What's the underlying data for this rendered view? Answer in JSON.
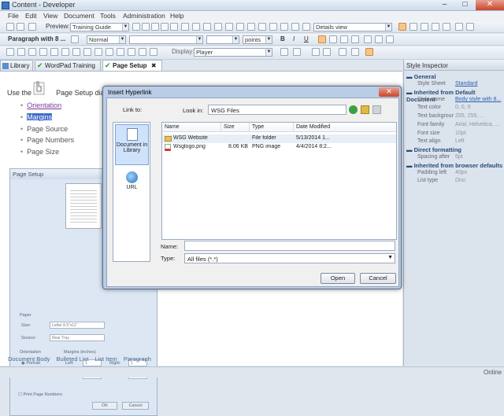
{
  "window": {
    "title": "Content - Developer"
  },
  "menu": [
    "File",
    "Edit",
    "View",
    "Document",
    "Tools",
    "Administration",
    "Help"
  ],
  "toolbar1": {
    "preview_label": "Preview:",
    "preview_value": "Training Guide",
    "view_value": "Details view"
  },
  "toolbar2": {
    "format_label": "Paragraph with 8 ...",
    "style_value": "Normal",
    "font_value": "",
    "size_value": "",
    "units_value": "points",
    "bold": "B",
    "italic": "I",
    "underline": "U"
  },
  "toolbar3": {
    "display_label": "Display:",
    "display_value": "Player"
  },
  "tabs": [
    {
      "label": "Library"
    },
    {
      "label": "WordPad Training"
    },
    {
      "label": "Page Setup"
    }
  ],
  "doc": {
    "intro": "Use the",
    "intro_tail": "Page Setup dialog",
    "bullets": [
      "Orientation",
      "Margins",
      "Page Source",
      "Page Numbers",
      "Page Size"
    ],
    "page_setup": {
      "title": "Page Setup",
      "paper_label": "Paper",
      "size_label": "Size:",
      "size_value": "Letter 8.5\"x11\"",
      "source_label": "Source:",
      "source_value": "Rear Tray",
      "orientation_label": "Orientation",
      "portrait": "Portrait",
      "landscape": "Landscape",
      "margins_label": "Margins (inches)",
      "left_label": "Left:",
      "left_value": "1",
      "right_label": "Right:",
      "right_value": "1",
      "top_label": "Top:",
      "top_value": "1",
      "bottom_label": "Bottom:",
      "bottom_value": "1",
      "print_numbers": "Print Page Numbers",
      "ok": "OK",
      "cancel": "Cancel"
    },
    "status_items": [
      "Document Body",
      "Bulleted List",
      "List Item",
      "Paragraph"
    ]
  },
  "inspector": {
    "title": "Style Inspector",
    "sections": [
      {
        "heading": "General",
        "rows": [
          {
            "k": "Style Sheet",
            "v": "Standard",
            "link": true
          }
        ]
      },
      {
        "heading": "Inherited from Default Document",
        "rows": [
          {
            "k": "Style name",
            "v": "Body style with 8...",
            "link": true
          },
          {
            "k": "Text color",
            "v": "0, 0, 0"
          },
          {
            "k": "Text backgrour",
            "v": "255, 255, ..."
          },
          {
            "k": "Font family",
            "v": "Arial, Helvetica, ..."
          },
          {
            "k": "Font size",
            "v": "10pt"
          },
          {
            "k": "Text align",
            "v": "Left"
          }
        ]
      },
      {
        "heading": "Direct formatting",
        "rows": [
          {
            "k": "Spacing after",
            "v": "6pt"
          }
        ]
      },
      {
        "heading": "Inherited from browser defaults",
        "rows": [
          {
            "k": "Padding left",
            "v": "40px"
          },
          {
            "k": "List type",
            "v": "Disc"
          }
        ]
      }
    ]
  },
  "status": {
    "online": "Online"
  },
  "dialog": {
    "title": "Insert Hyperlink",
    "link_to_label": "Link to:",
    "look_in_label": "Look in:",
    "look_in_value": "WSG Files",
    "places": [
      {
        "label": "Document in Library",
        "icon": "document-library-icon"
      },
      {
        "label": "URL",
        "icon": "globe-icon"
      }
    ],
    "columns": [
      "Name",
      "Size",
      "Type",
      "Date Modified"
    ],
    "files": [
      {
        "name": "WSG Website",
        "size": "",
        "type": "File folder",
        "date": "5/13/2014 1...",
        "icon": "folder-icon"
      },
      {
        "name": "Wsglogo.png",
        "size": "8.06 KB",
        "type": "PNG image",
        "date": "4/4/2014 8:2...",
        "icon": "image-file-icon"
      }
    ],
    "name_label": "Name:",
    "name_value": "",
    "type_label": "Type:",
    "type_value": "All files (*.*)",
    "open": "Open",
    "cancel": "Cancel"
  }
}
